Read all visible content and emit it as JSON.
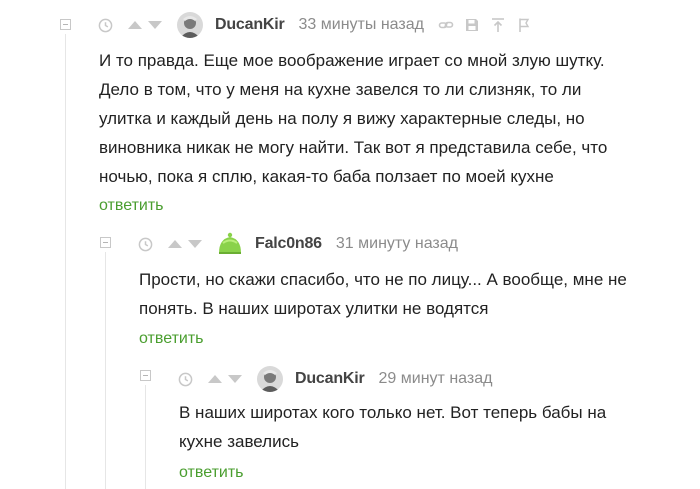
{
  "comments": [
    {
      "nick": "DucanKir",
      "time": "33 минуты назад",
      "lines": [
        "И то правда. Еще мое воображение играет со мной злую шутку.",
        "Дело в том, что у меня на кухне завелся то ли слизняк, то ли",
        "улитка и каждый день на полу я вижу характерные следы, но",
        "виновника никак не могу найти. Так вот я представила себе, что",
        "ночью, пока я сплю, какая-то баба ползает по моей кухне"
      ],
      "reply": "ответить",
      "avatar_icon": "samurai-avatar",
      "tools": [
        "link-icon",
        "save-icon",
        "upload-icon",
        "flag-icon"
      ]
    },
    {
      "nick": "Falc0n86",
      "time": "31 минуту назад",
      "lines": [
        "Прости, но скажи спасибо, что не по лицу... А вообще, мне не",
        "понять. В наших широтах улитки не водятся"
      ],
      "reply": "ответить",
      "avatar_icon": "green-slime-avatar"
    },
    {
      "nick": "DucanKir",
      "time": "29 минут назад",
      "lines": [
        "В наших широтах кого только нет. Вот теперь бабы на",
        "кухне завелись"
      ],
      "reply": "ответить",
      "avatar_icon": "samurai-avatar"
    }
  ],
  "colors": {
    "reply_link": "#4a9e2f",
    "nick": "#444444",
    "time": "#8b8b8b",
    "icons": "#c8c8c8"
  }
}
